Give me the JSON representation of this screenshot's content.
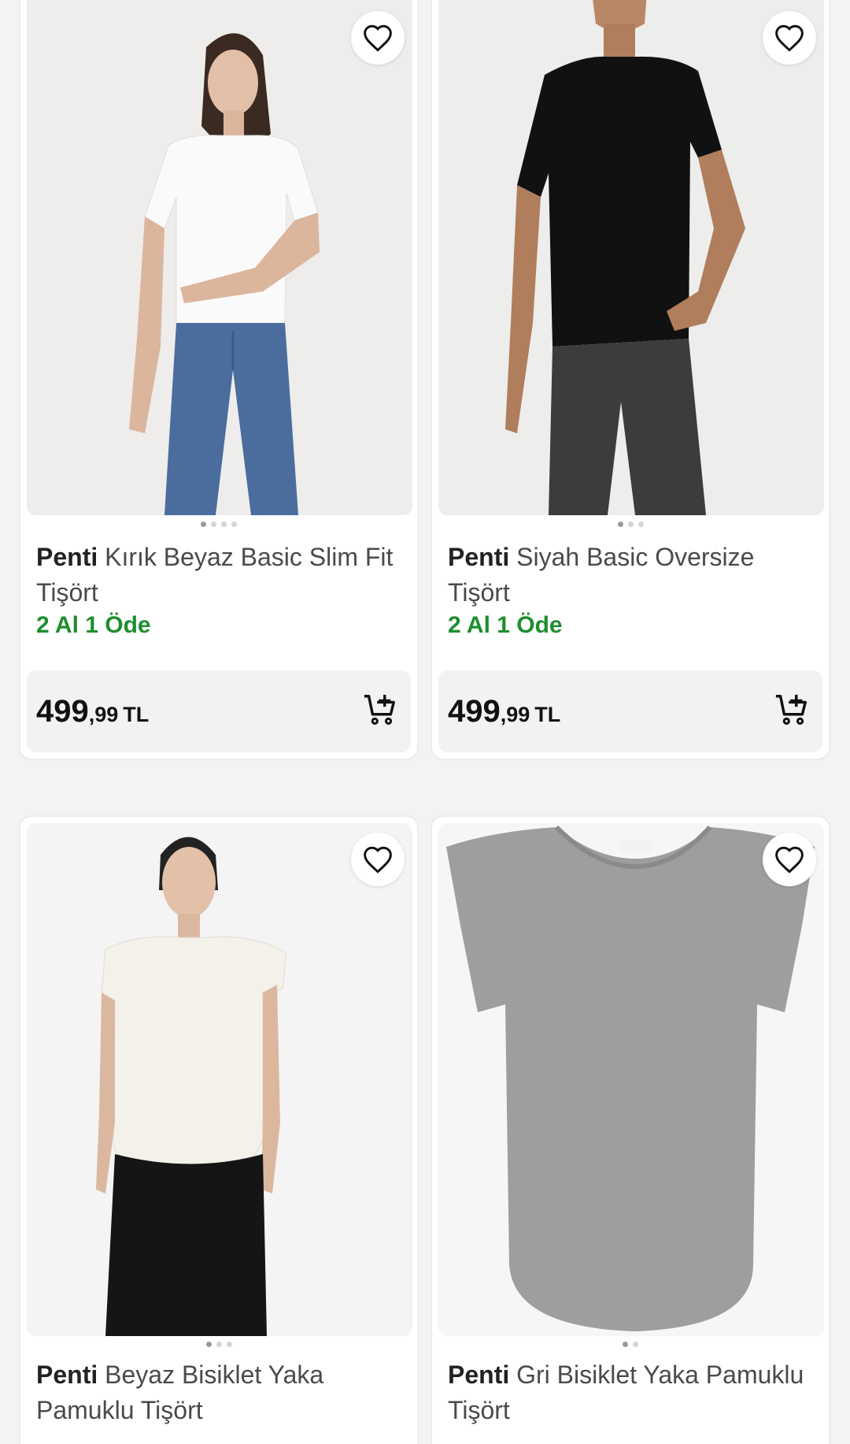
{
  "products": [
    {
      "brand": "Penti",
      "name": "Kırık Beyaz Basic Slim Fit Tişört",
      "promo": "2 Al 1 Öde",
      "price_int": "499",
      "price_dec": ",99",
      "currency": "TL",
      "image_slides": 4,
      "active_slide": 1
    },
    {
      "brand": "Penti",
      "name": "Siyah Basic Oversize Tişört",
      "promo": "2 Al 1 Öde",
      "price_int": "499",
      "price_dec": ",99",
      "currency": "TL",
      "image_slides": 3,
      "active_slide": 1
    },
    {
      "brand": "Penti",
      "name": "Beyaz Bisiklet Yaka Pamuklu Tişört",
      "image_slides": 3,
      "active_slide": 1
    },
    {
      "brand": "Penti",
      "name": "Gri Bisiklet Yaka Pamuklu Tişört",
      "image_slides": 2,
      "active_slide": 1
    }
  ],
  "icons": {
    "favorite": "heart-outline-icon",
    "add_to_cart": "cart-plus-icon"
  },
  "colors": {
    "promo": "#1e8e2e",
    "price_bar": "#f2f2f2",
    "page_bg": "#f3f3f3"
  }
}
